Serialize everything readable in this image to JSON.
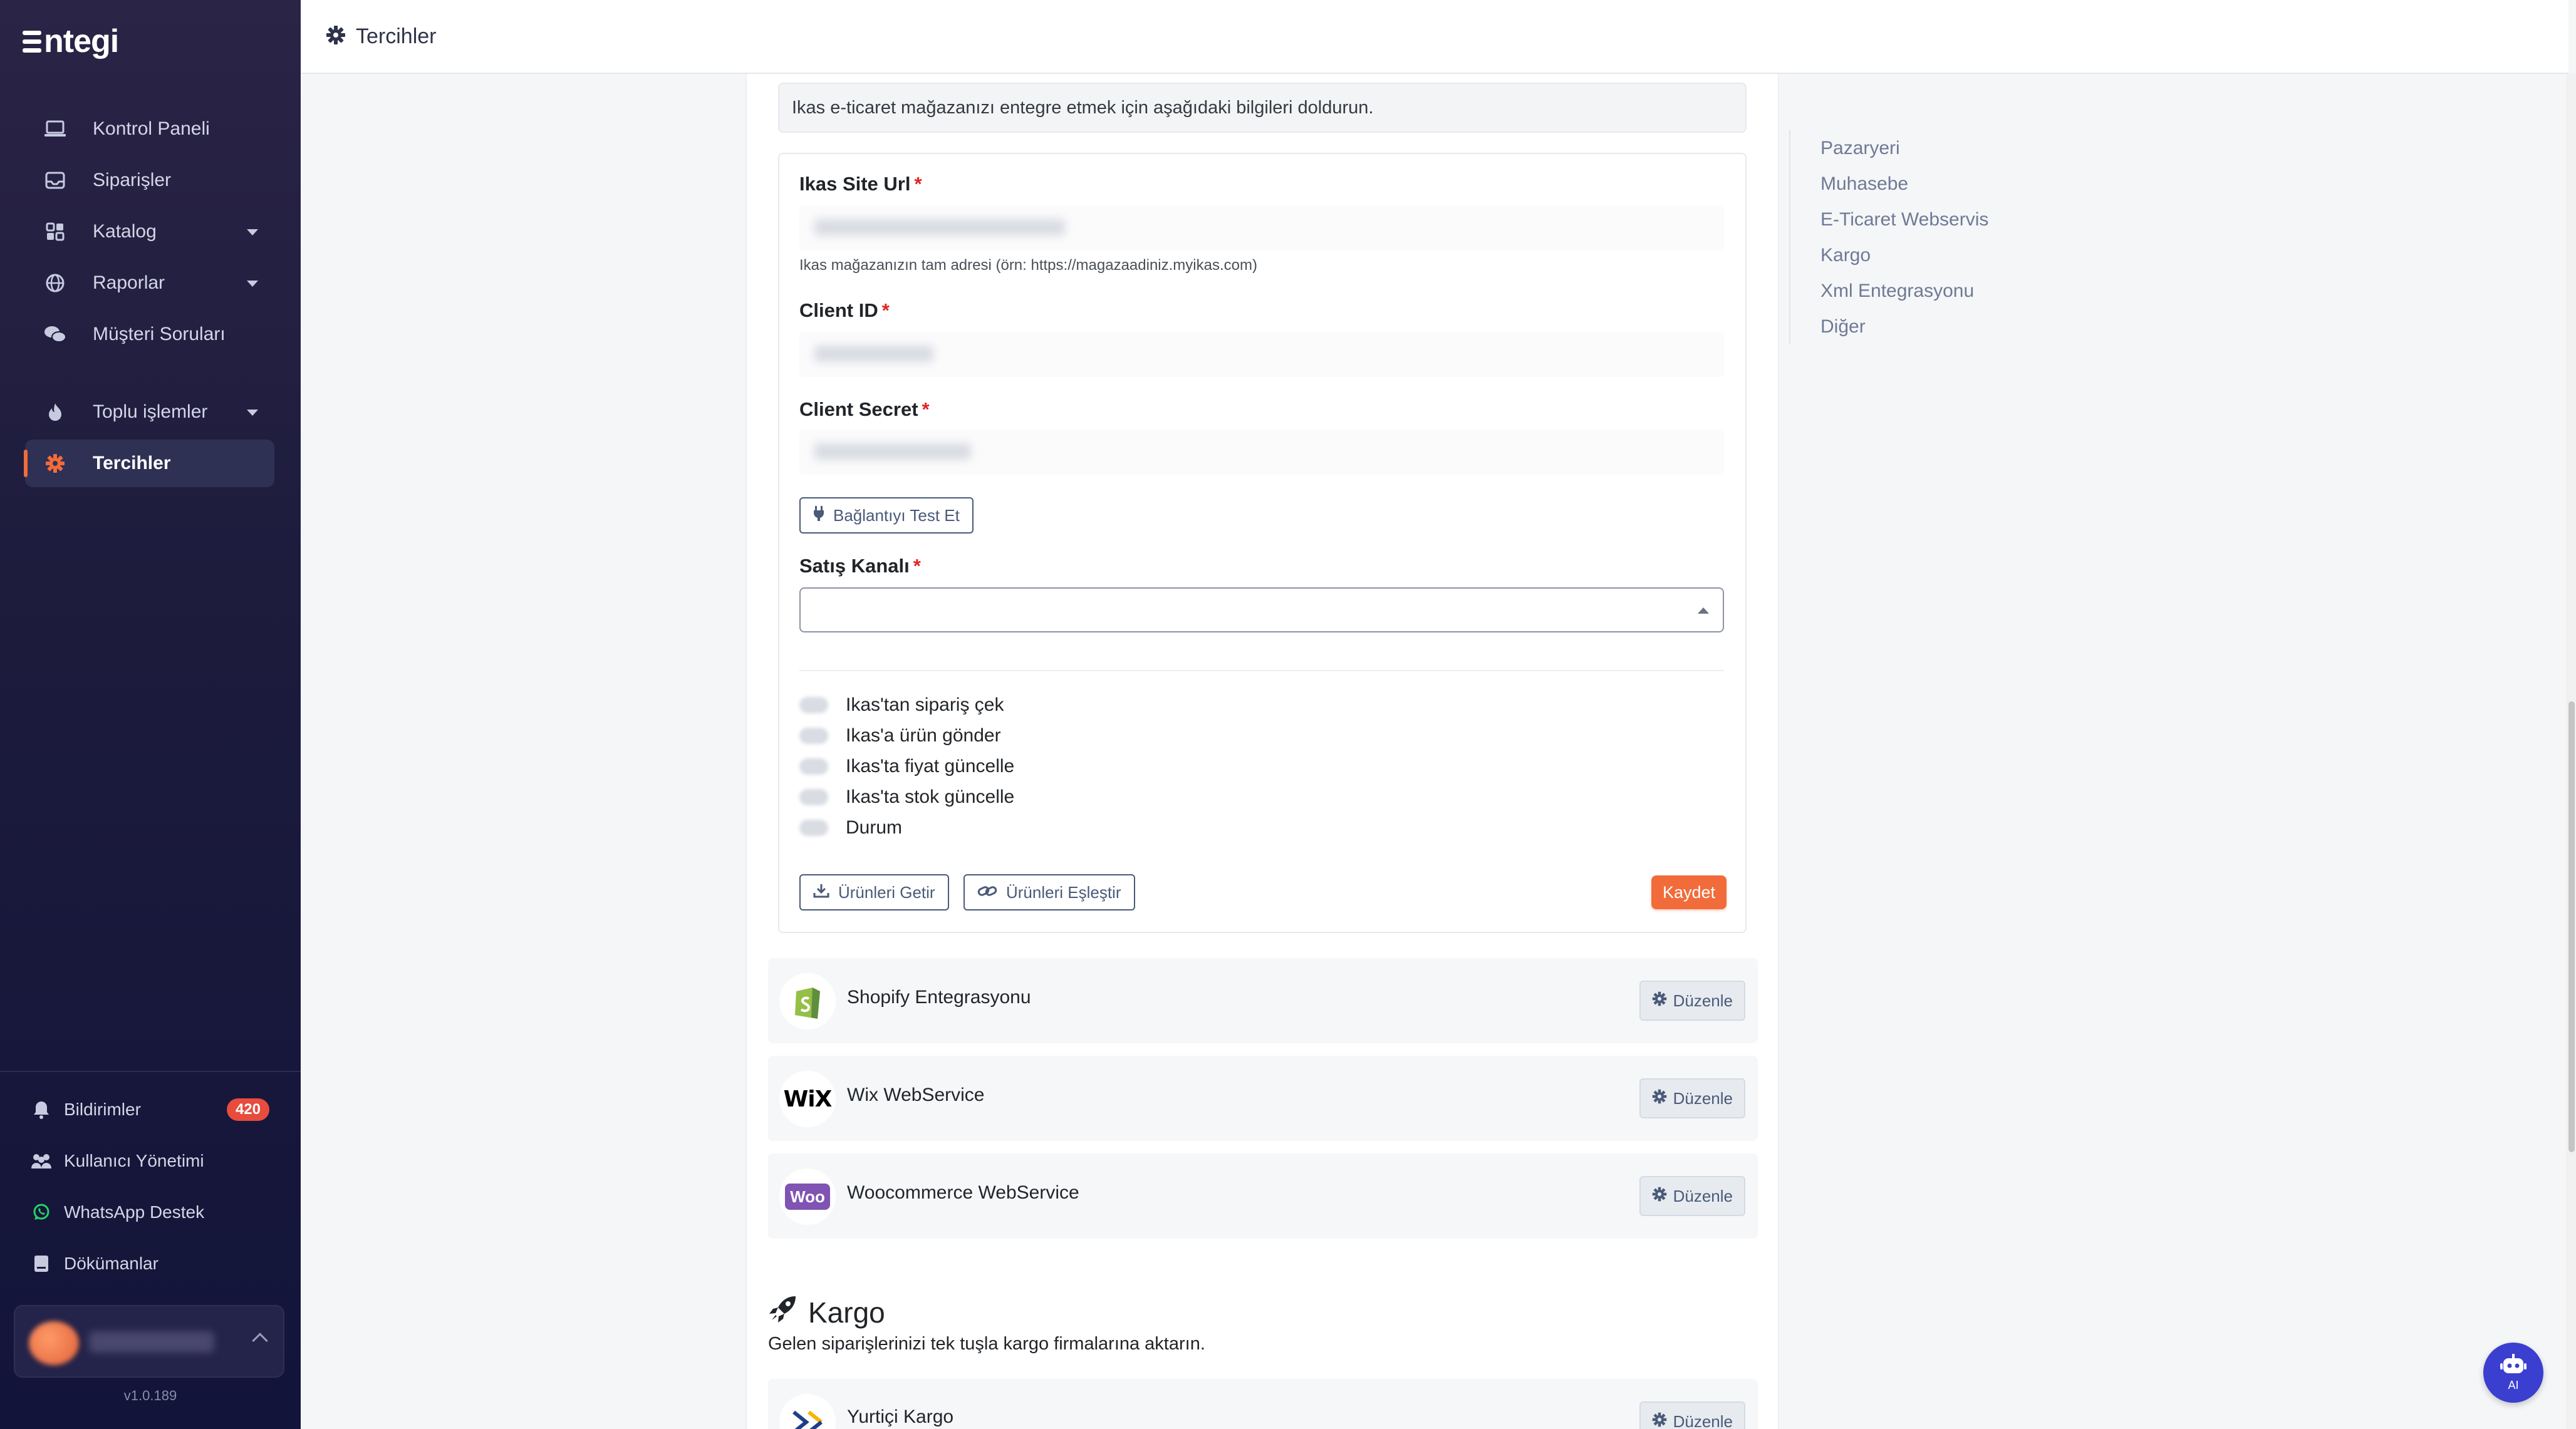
{
  "app": {
    "logo_text": "ntegi",
    "version": "v1.0.189"
  },
  "sidebar": {
    "items": [
      {
        "label": "Kontrol Paneli",
        "icon": "laptop-icon"
      },
      {
        "label": "Siparişler",
        "icon": "inbox-icon"
      },
      {
        "label": "Katalog",
        "icon": "grid-icon"
      },
      {
        "label": "Raporlar",
        "icon": "globe-icon"
      },
      {
        "label": "Müşteri Soruları",
        "icon": "chat-icon"
      },
      {
        "label": "Toplu işlemler",
        "icon": "fire-icon"
      },
      {
        "label": "Tercihler",
        "icon": "gear-icon"
      }
    ],
    "bottom": [
      {
        "label": "Bildirimler",
        "badge": "420"
      },
      {
        "label": "Kullanıcı Yönetimi"
      },
      {
        "label": "WhatsApp Destek"
      },
      {
        "label": "Dökümanlar"
      }
    ]
  },
  "header": {
    "title": "Tercihler"
  },
  "ikas": {
    "info": "Ikas e-ticaret mağazanızı entegre etmek için aşağıdaki bilgileri doldurun.",
    "site_url_label": "Ikas Site Url",
    "site_url_help": "Ikas mağazanızın tam adresi (örn: https://magazaadiniz.myikas.com)",
    "client_id_label": "Client ID",
    "client_secret_label": "Client Secret",
    "required_mark": "*",
    "test_button": "Bağlantıyı Test Et",
    "sales_channel_label": "Satış Kanalı",
    "options": [
      "Ikas'tan sipariş çek",
      "Ikas'a ürün gönder",
      "Ikas'ta fiyat güncelle",
      "Ikas'ta stok güncelle",
      "Durum"
    ],
    "fetch_products_button": "Ürünleri Getir",
    "match_products_button": "Ürünleri Eşleştir",
    "save_button": "Kaydet"
  },
  "integrations": [
    {
      "name": "Shopify Entegrasyonu",
      "edit": "Düzenle"
    },
    {
      "name": "Wix WebService",
      "edit": "Düzenle",
      "logo_text": "WiX"
    },
    {
      "name": "Woocommerce WebService",
      "edit": "Düzenle",
      "logo_text": "Woo"
    }
  ],
  "kargo": {
    "title": "Kargo",
    "subtitle": "Gelen siparişlerinizi tek tuşla kargo firmalarına aktarın.",
    "first_item": "Yurtiçi Kargo",
    "edit": "Düzenle"
  },
  "anchor_nav": [
    "Pazaryeri",
    "Muhasebe",
    "E-Ticaret Webservis",
    "Kargo",
    "Xml Entegrasyonu",
    "Diğer"
  ],
  "ai_button": {
    "label": "AI"
  },
  "colors": {
    "accent": "#f26b3a",
    "sidebar_bg": "#1c1b3c",
    "badge": "#e74c3c",
    "ai_button": "#3a3fd0"
  }
}
